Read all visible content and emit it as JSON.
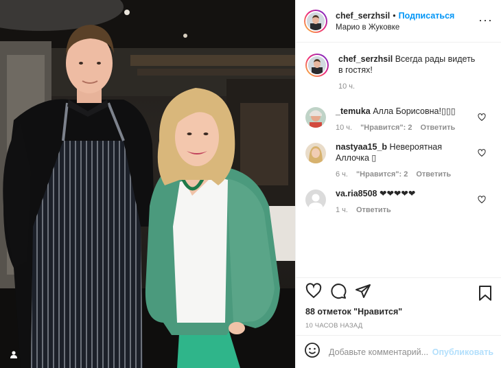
{
  "post": {
    "username": "chef_serzhsil",
    "follow_label": "Подписаться",
    "dot": "•",
    "location": "Марио в Жуковке"
  },
  "caption": {
    "username": "chef_serzhsil",
    "text": "Всегда рады видеть в гостях!",
    "time": "10 ч."
  },
  "comments": [
    {
      "username": "_temuka",
      "text": "Алла Борисовна!▯▯▯",
      "time": "10 ч.",
      "likes_label": "\"Нравится\": 2",
      "reply_label": "Ответить"
    },
    {
      "username": "nastyaa15_b",
      "text": "Невероятная Аллочка ▯",
      "time": "6 ч.",
      "likes_label": "\"Нравится\": 2",
      "reply_label": "Ответить"
    },
    {
      "username": "va.ria8508",
      "text": "❤❤❤❤❤",
      "time": "1 ч.",
      "likes_label": "",
      "reply_label": "Ответить"
    }
  ],
  "actions": {
    "likes_text": "88 отметок \"Нравится\"",
    "time_ago": "10 ЧАСОВ НАЗАД"
  },
  "add_comment": {
    "placeholder": "Добавьте комментарий...",
    "publish_label": "Опубликовать"
  },
  "icons": [
    "user-tag-icon",
    "more-icon",
    "heart-icon",
    "comment-icon",
    "share-icon",
    "bookmark-icon",
    "emoji-icon"
  ]
}
